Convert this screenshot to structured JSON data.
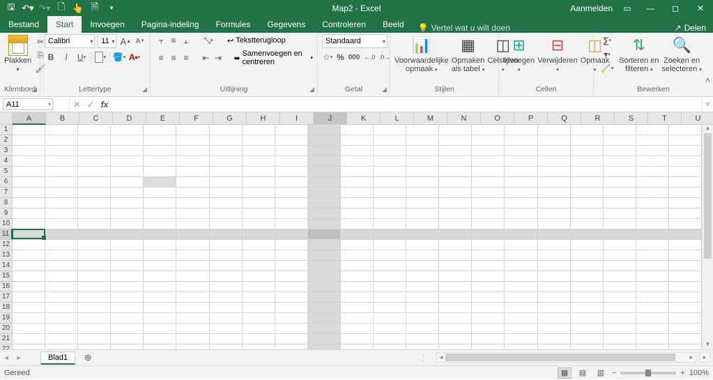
{
  "title": "Map2  -  Excel",
  "account": {
    "signin": "Aanmelden"
  },
  "qat_icons": [
    "save",
    "undo",
    "redo",
    "preview",
    "touch",
    "new",
    "more"
  ],
  "tabs": {
    "file": "Bestand",
    "home": "Start",
    "insert": "Invoegen",
    "layout": "Pagina-indeling",
    "formulas": "Formules",
    "data": "Gegevens",
    "review": "Controleren",
    "view": "Beeld"
  },
  "tellme": "Vertel wat u wilt doen",
  "share": "Delen",
  "ribbon": {
    "clipboard": {
      "label": "Klembord",
      "paste": "Plakken"
    },
    "font": {
      "label": "Lettertype",
      "name": "Calibri",
      "size": "11"
    },
    "alignment": {
      "label": "Uitlijning",
      "wrap": "Tekstterugloop",
      "merge": "Samenvoegen en centreren"
    },
    "number": {
      "label": "Getal",
      "format": "Standaard"
    },
    "styles": {
      "label": "Stijlen",
      "cond": "Voorwaardelijke\nopmaak",
      "table": "Opmaken\nals tabel",
      "cellstyles": "Celstijlen"
    },
    "cells": {
      "label": "Cellen",
      "insert": "Invoegen",
      "delete": "Verwijderen",
      "format": "Opmaak"
    },
    "editing": {
      "label": "Bewerken",
      "sort": "Sorteren en\nfilteren",
      "find": "Zoeken en\nselecteren"
    }
  },
  "namebox": "A11",
  "columns": [
    "A",
    "B",
    "C",
    "D",
    "E",
    "F",
    "G",
    "H",
    "I",
    "J",
    "K",
    "L",
    "M",
    "N",
    "O",
    "P",
    "Q",
    "R",
    "S",
    "T",
    "U"
  ],
  "rows": 23,
  "selected_col_index": 9,
  "selected_row_index": 10,
  "active_col_index": 0,
  "extra_highlight_cell": {
    "row": 5,
    "col": 4
  },
  "sheet": {
    "name": "Blad1"
  },
  "status": {
    "ready": "Gereed",
    "zoom": "100%"
  }
}
